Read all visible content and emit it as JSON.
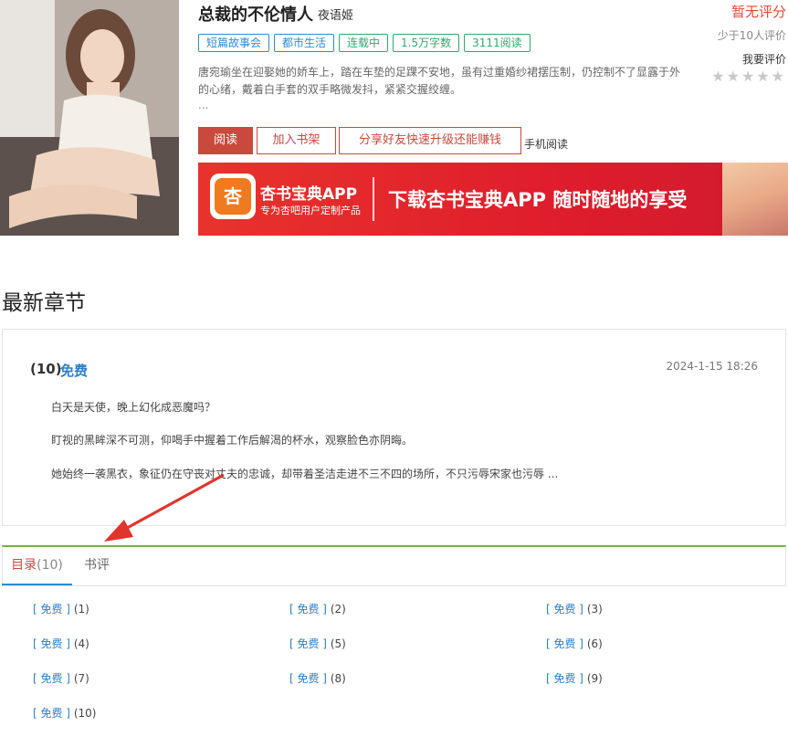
{
  "book": {
    "title": "总裁的不伦情人",
    "author": "夜语姬",
    "tags": [
      {
        "label": "短篇故事会",
        "color": "blue"
      },
      {
        "label": "都市生活",
        "color": "blue"
      },
      {
        "label": "连载中",
        "color": "green"
      },
      {
        "label": "1.5万字数",
        "color": "green"
      },
      {
        "label": "3111阅读",
        "color": "green"
      }
    ],
    "description": "唐宛瑜坐在迎娶她的娇车上，踏在车垫的足踝不安地，虽有过重婚纱裙摆压制，仍控制不了显露于外的心绪，戴着白手套的双手略微发抖，紧紧交握绞缠。",
    "ellipsis": "...",
    "rating": "暂无评分",
    "rating_count": "少于10人评价",
    "rate_me": "我要评价",
    "stars": "★★★★★"
  },
  "actions": {
    "read": "阅读",
    "add_shelf": "加入书架",
    "share": "分享好友快速升级还能赚钱",
    "mobile": "手机阅读"
  },
  "banner": {
    "logo_char": "杏",
    "app_name": "杏书宝典APP",
    "app_sub": "专为杏吧用户定制产品",
    "slogan": "下载杏书宝典APP 随时随地的享受"
  },
  "latest": {
    "section_title": "最新章节",
    "chapter_num": "(10)",
    "chapter_free": "免费",
    "time": "2024-1-15 18:26",
    "lines": [
      "白天是天使，晚上幻化成恶魔吗？",
      "盯视的黑眸深不可测，仰喝手中握着工作后解渴的杯水，观察脸色亦阴晦。",
      "她始终一袭黑衣，象征仍在守丧对丈夫的忠诚，却带着圣洁走进不三不四的场所，不只污辱宋家也污辱 ..."
    ]
  },
  "tabs": {
    "toc_label": "目录",
    "toc_count": "(10)",
    "review_label": "书评"
  },
  "toc": [
    {
      "free": "[ 免费 ]",
      "num": "(1)"
    },
    {
      "free": "[ 免费 ]",
      "num": "(2)"
    },
    {
      "free": "[ 免费 ]",
      "num": "(3)"
    },
    {
      "free": "[ 免费 ]",
      "num": "(4)"
    },
    {
      "free": "[ 免费 ]",
      "num": "(5)"
    },
    {
      "free": "[ 免费 ]",
      "num": "(6)"
    },
    {
      "free": "[ 免费 ]",
      "num": "(7)"
    },
    {
      "free": "[ 免费 ]",
      "num": "(8)"
    },
    {
      "free": "[ 免费 ]",
      "num": "(9)"
    },
    {
      "free": "[ 免费 ]",
      "num": "(10)"
    }
  ],
  "colors": {
    "accent_red": "#c94a3c",
    "link_blue": "#2d7fc9",
    "tab_green": "#6db24a",
    "annotation_arrow": "#e0342c"
  }
}
